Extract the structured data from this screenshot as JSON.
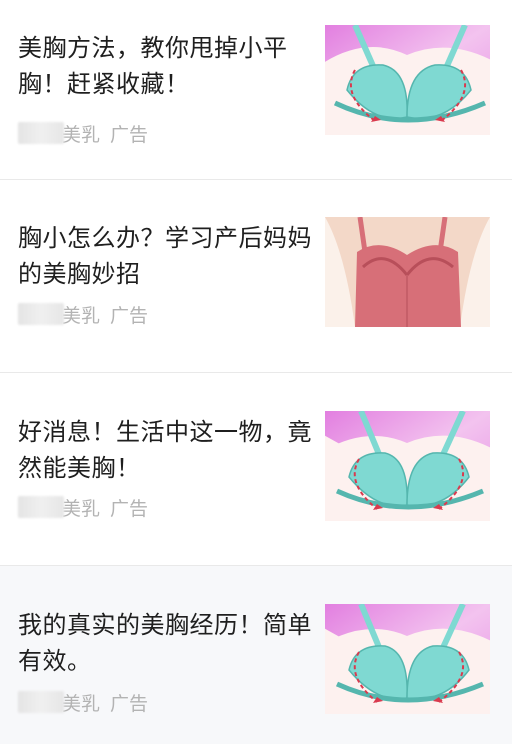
{
  "feed": {
    "items": [
      {
        "title": "美胸方法，教你甩掉小平胸！赶紧收藏！",
        "source": "美乳",
        "tag": "广告",
        "image": "teal-bra-illustration-icon"
      },
      {
        "title": "胸小怎么办？学习产后妈妈的美胸妙招",
        "source": "美乳",
        "tag": "广告",
        "image": "red-bra-illustration-icon"
      },
      {
        "title": "好消息！生活中这一物，竟然能美胸！",
        "source": "美乳",
        "tag": "广告",
        "image": "teal-bra-illustration-icon"
      },
      {
        "title": "我的真实的美胸经历！简单有效。",
        "source": "美乳",
        "tag": "广告",
        "image": "teal-bra-illustration-icon"
      }
    ]
  },
  "colors": {
    "title": "#1f1f1f",
    "meta": "#b3b3b3",
    "divider": "#e9e9e9",
    "thumb_pink": "#ea9be8",
    "bra_teal": "#7fd9d2",
    "bra_red": "#d76f78"
  }
}
